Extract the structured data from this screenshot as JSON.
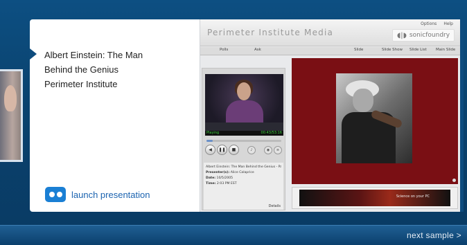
{
  "presentation": {
    "title_lines": [
      "Albert Einstein: The Man",
      "Behind the Genius",
      "Perimeter Institute"
    ],
    "launch_label": "launch presentation"
  },
  "footer": {
    "next_sample": "next sample >"
  },
  "player": {
    "brand": "Perimeter Institute Media",
    "header_links": [
      "Options",
      "Help"
    ],
    "logo_text": "sonicfoundry",
    "tabs": [
      "Polls",
      "Ask",
      "Slide",
      "Slide Show",
      "Slide List",
      "Main Slide"
    ],
    "video_status": {
      "left": "Playing",
      "right": "00:43/53:16"
    },
    "progress": 0.08,
    "info": {
      "title": "Albert Einstein: The Man Behind the Genius - Pan ages 13 and up",
      "presenter_label": "Presenter(s):",
      "presenter": "Alice Calaprice",
      "date_label": "Date:",
      "date": "10/5/2005",
      "time_label": "Time:",
      "time": "2:03 PM EST",
      "details_label": "Details"
    },
    "banner_text": "Science on your PC"
  },
  "colors": {
    "accent_blue": "#1a7fd4",
    "slide_bg": "#7a0f14"
  }
}
